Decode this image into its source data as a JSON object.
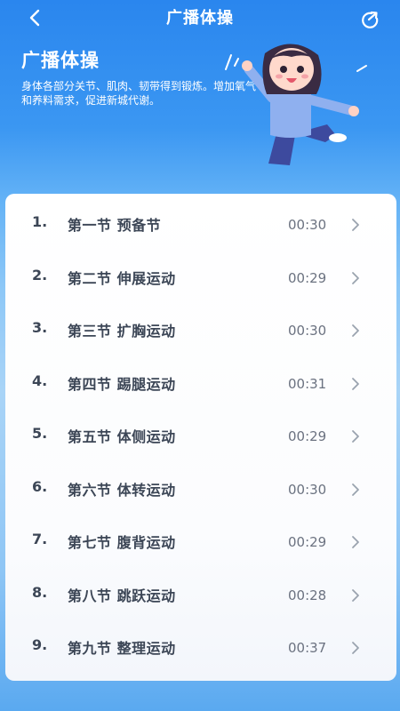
{
  "colors": {
    "primary": "#2a86ee",
    "text": "#3c4656",
    "muted": "#6b7280",
    "card": "#ffffff"
  },
  "topbar": {
    "title": "广播体操",
    "back_icon": "chevron-left-icon",
    "share_icon": "share-icon"
  },
  "hero": {
    "title": "广播体操",
    "description": "身体各部分关节、肌肉、韧带得到锻炼。增加氧气和养料需求，促进新城代谢。"
  },
  "sections": [
    {
      "index": "1.",
      "name": "第一节 预备节",
      "duration": "00:30"
    },
    {
      "index": "2.",
      "name": "第二节 伸展运动",
      "duration": "00:29"
    },
    {
      "index": "3.",
      "name": "第三节 扩胸运动",
      "duration": "00:30"
    },
    {
      "index": "4.",
      "name": "第四节 踢腿运动",
      "duration": "00:31"
    },
    {
      "index": "5.",
      "name": "第五节 体侧运动",
      "duration": "00:29"
    },
    {
      "index": "6.",
      "name": "第六节 体转运动",
      "duration": "00:30"
    },
    {
      "index": "7.",
      "name": "第七节 腹背运动",
      "duration": "00:29"
    },
    {
      "index": "8.",
      "name": "第八节 跳跃运动",
      "duration": "00:28"
    },
    {
      "index": "9.",
      "name": "第九节 整理运动",
      "duration": "00:37"
    }
  ]
}
